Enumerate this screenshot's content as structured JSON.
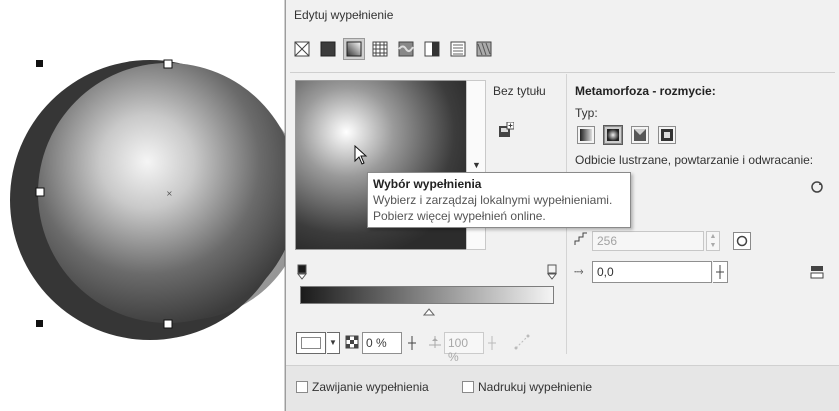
{
  "dialog": {
    "title": "Edytuj wypełnienie"
  },
  "fill_types": [
    "no-fill-icon",
    "uniform-fill-icon",
    "gradient-fill-icon",
    "pattern-fill-icon",
    "bitmap-fill-icon",
    "two-color-fill-icon",
    "postscript-fill-icon",
    "texture-fill-icon"
  ],
  "library": {
    "untitled_label": "Bez tytułu"
  },
  "settings": {
    "heading": "Metamorfoza - rozmycie:",
    "type_label": "Typ:",
    "mirror_label": "Odbicie lustrzane, powtarzanie i odwracanie:",
    "steps_value": "256",
    "offset_value": "0,0"
  },
  "controls": {
    "transparency_value": "0 %",
    "scale_value": "100 %"
  },
  "tooltip": {
    "title": "Wybór wypełnienia",
    "line1": "Wybierz i zarządzaj lokalnymi wypełnieniami.",
    "line2": "Pobierz więcej wypełnień online."
  },
  "footer": {
    "wrap_label": "Zawijanie wypełnienia",
    "overprint_label": "Nadrukuj wypełnienie"
  },
  "colors": {
    "gradient_start": "#1b1b1b",
    "gradient_end": "#f4f4f4"
  }
}
